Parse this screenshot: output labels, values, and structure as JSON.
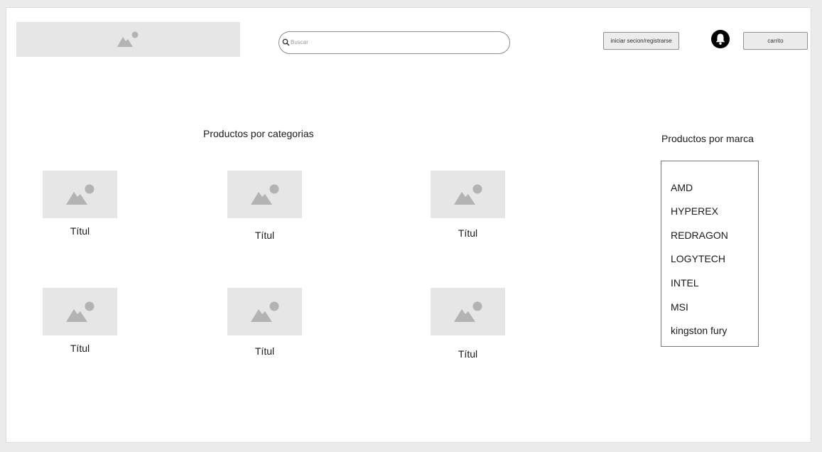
{
  "header": {
    "search": {
      "placeholder": "Buscar"
    },
    "login_label": "iniciar secion/registrarse",
    "cart_label": "carrito"
  },
  "icons": {
    "logo": "image-placeholder-icon",
    "search": "search-icon",
    "notifications": "bell-icon",
    "product_image": "image-placeholder-icon"
  },
  "categories": {
    "title": "Productos por categorias",
    "items": [
      {
        "caption": "Títul"
      },
      {
        "caption": "Títul"
      },
      {
        "caption": "Títul"
      },
      {
        "caption": "Títul"
      },
      {
        "caption": "Títul"
      },
      {
        "caption": "Títul"
      }
    ]
  },
  "brands": {
    "title": "Productos por marca",
    "items": [
      "AMD",
      "HYPEREX",
      "REDRAGON",
      "LOGYTECH",
      "INTEL",
      "MSI",
      "kingston fury"
    ]
  }
}
